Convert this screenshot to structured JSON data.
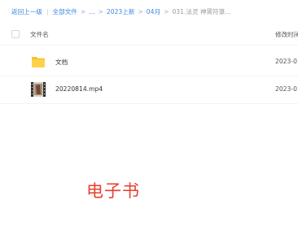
{
  "breadcrumb": {
    "back_label": "返回上一级",
    "all_files_label": "全部文件",
    "ellipsis": "...",
    "items": [
      "2023上新",
      "04月"
    ],
    "current": "031.法灵 神霄符箓..."
  },
  "table": {
    "col_name": "文件名",
    "col_modified": "修改时间"
  },
  "files": [
    {
      "name": "文档",
      "type": "folder",
      "modified": "2023-0"
    },
    {
      "name": "20220814.mp4",
      "type": "video",
      "modified": "2023-0"
    }
  ],
  "overlay_text": "电子书",
  "colors": {
    "link": "#3a86e8",
    "folder": "#f8c133",
    "watermark": "#e5402f"
  }
}
